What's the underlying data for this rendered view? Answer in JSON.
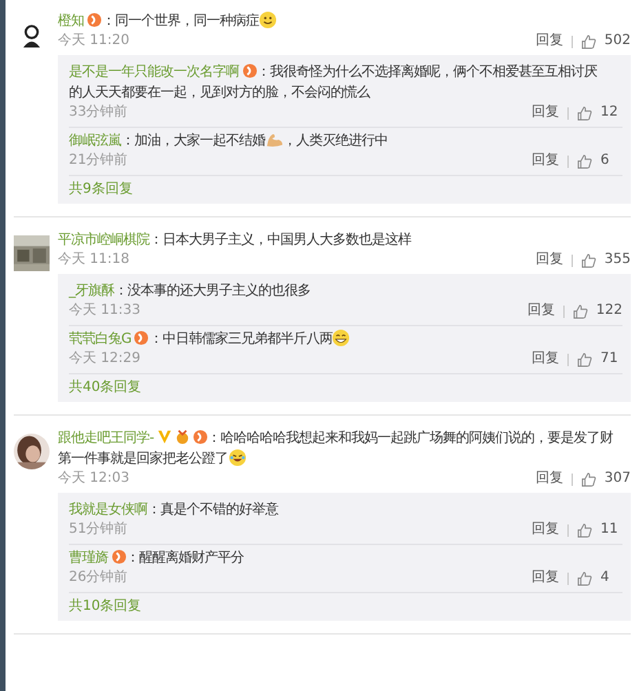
{
  "comments": [
    {
      "avatar": {
        "kind": "drawing"
      },
      "name": "橙知",
      "badges": [
        {
          "kind": "member"
        }
      ],
      "content": [
        {
          "kind": "text",
          "text": "：同一个世界，同一种病症"
        },
        {
          "kind": "smile"
        }
      ],
      "time": "今天 11:20",
      "reply_label": "回复",
      "likes": "502",
      "replies": [
        {
          "name": "是不是一年只能改一次名字啊",
          "badges": [
            {
              "kind": "member"
            }
          ],
          "content": [
            {
              "kind": "text",
              "text": "：我很奇怪为什么不选择离婚呢，俩个不相爱甚至互相讨厌"
            },
            {
              "kind": "next_line",
              "text": "的人天天都要在一起，见到对方的脸，不会闷的慌么"
            }
          ],
          "time": "33分钟前",
          "reply_label": "回复",
          "likes": "12"
        },
        {
          "name": "御岷弦嵐",
          "content": [
            {
              "kind": "text",
              "text": "：加油，大家一起不结婚"
            },
            {
              "kind": "muscle"
            },
            {
              "kind": "text",
              "text": "，人类灭绝进行中"
            }
          ],
          "time": "21分钟前",
          "reply_label": "回复",
          "likes": "6"
        }
      ],
      "more": "共9条回复"
    },
    {
      "avatar": {
        "kind": "square"
      },
      "name": "平凉市崆峒棋院",
      "content": [
        {
          "kind": "text",
          "text": "：日本大男子主义，中国男人大多数也是这样"
        }
      ],
      "time": "今天 11:18",
      "reply_label": "回复",
      "likes": "355",
      "replies": [
        {
          "name": "_牙旗酥",
          "content": [
            {
              "kind": "text",
              "text": "：没本事的还大男子主义的也很多"
            }
          ],
          "time": "今天 11:33",
          "reply_label": "回复",
          "likes": "122"
        },
        {
          "name": "茕茕白兔G",
          "badges": [
            {
              "kind": "member"
            }
          ],
          "content": [
            {
              "kind": "text",
              "text": "：中日韩儒家三兄弟都半斤八两"
            },
            {
              "kind": "grin"
            }
          ],
          "time": "今天 12:29",
          "reply_label": "回复",
          "likes": "71"
        }
      ],
      "more": "共40条回复"
    },
    {
      "avatar": {
        "kind": "round"
      },
      "name": "跟他走吧王同学-",
      "badges": [
        {
          "kind": "verified"
        },
        {
          "kind": "medal"
        },
        {
          "kind": "member"
        }
      ],
      "content": [
        {
          "kind": "text",
          "text": "：哈哈哈哈哈我想起来和我妈一起跳广场舞的阿姨们说的，要是发了财"
        },
        {
          "kind": "next_line",
          "text": "第一件事就是回家把老公蹬了"
        },
        {
          "kind": "laugh"
        }
      ],
      "time": "今天 12:03",
      "reply_label": "回复",
      "likes": "307",
      "replies": [
        {
          "name": "我就是女侠啊",
          "content": [
            {
              "kind": "text",
              "text": "：真是个不错的好举意"
            }
          ],
          "time": "51分钟前",
          "reply_label": "回复",
          "likes": "11"
        },
        {
          "name": "曹瑾旖",
          "badges": [
            {
              "kind": "member"
            }
          ],
          "content": [
            {
              "kind": "text",
              "text": "：醒醒离婚财产平分"
            }
          ],
          "time": "26分钟前",
          "reply_label": "回复",
          "likes": "4"
        }
      ],
      "more": "共10条回复"
    }
  ]
}
